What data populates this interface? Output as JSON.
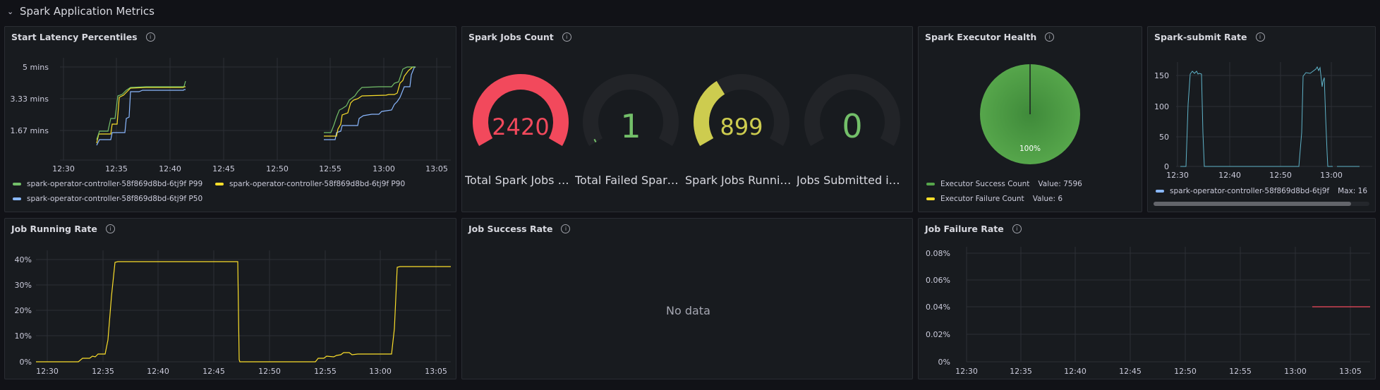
{
  "row": {
    "title": "Spark Application Metrics"
  },
  "panels": {
    "latency": {
      "title": "Start Latency Percentiles",
      "yticks": [
        "5 mins",
        "3.33 mins",
        "1.67 mins"
      ],
      "xticks": [
        "12:30",
        "12:35",
        "12:40",
        "12:45",
        "12:50",
        "12:55",
        "13:00",
        "13:05"
      ],
      "legend": [
        {
          "name": "spark-operator-controller-58f869d8bd-6tj9f P99",
          "color": "#73bf69"
        },
        {
          "name": "spark-operator-controller-58f869d8bd-6tj9f P90",
          "color": "#fade2a"
        },
        {
          "name": "spark-operator-controller-58f869d8bd-6tj9f P50",
          "color": "#8ab8ff"
        }
      ]
    },
    "jobs_count": {
      "title": "Spark Jobs Count",
      "gauges": [
        {
          "value": "2420",
          "label": "Total Spark Jobs C...",
          "color": "#f2495c",
          "fraction": 1.0
        },
        {
          "value": "1",
          "label": "Total Failed Spark ...",
          "color": "#73bf69",
          "fraction": 0.02
        },
        {
          "value": "899",
          "label": "Spark Jobs Running",
          "color": "#cdcc4f",
          "fraction": 0.37
        },
        {
          "value": "0",
          "label": "Jobs Submitted in ...",
          "color": "#73bf69",
          "fraction": 0.0
        }
      ]
    },
    "executor": {
      "title": "Spark Executor Health",
      "pie_label": "100%",
      "legend": [
        {
          "name": "Executor Success Count",
          "value_text": "Value: 7596",
          "value": 7596,
          "color": "#56a64b"
        },
        {
          "name": "Executor Failure Count",
          "value_text": "Value: 6",
          "value": 6,
          "color": "#fade2a"
        }
      ]
    },
    "submit": {
      "title": "Spark-submit Rate",
      "yticks": [
        "150",
        "100",
        "50",
        "0"
      ],
      "xticks": [
        "12:30",
        "12:40",
        "12:50",
        "13:00"
      ],
      "legend": {
        "name": "spark-operator-controller-58f869d8bd-6tj9f",
        "max": "Max: 16",
        "color": "#8ab8ff"
      }
    },
    "running": {
      "title": "Job Running Rate",
      "yticks": [
        "40%",
        "30%",
        "20%",
        "10%",
        "0%"
      ],
      "xticks": [
        "12:30",
        "12:35",
        "12:40",
        "12:45",
        "12:50",
        "12:55",
        "13:00",
        "13:05"
      ]
    },
    "success": {
      "title": "Job Success Rate",
      "nodata": "No data"
    },
    "failure": {
      "title": "Job Failure Rate",
      "yticks": [
        "0.08%",
        "0.06%",
        "0.04%",
        "0.02%",
        "0%"
      ],
      "xticks": [
        "12:30",
        "12:35",
        "12:40",
        "12:45",
        "12:50",
        "12:55",
        "13:00",
        "13:05"
      ]
    }
  },
  "colors": {
    "background": "#111217",
    "panel": "#181b1f",
    "grid": "#2c2f35"
  }
}
